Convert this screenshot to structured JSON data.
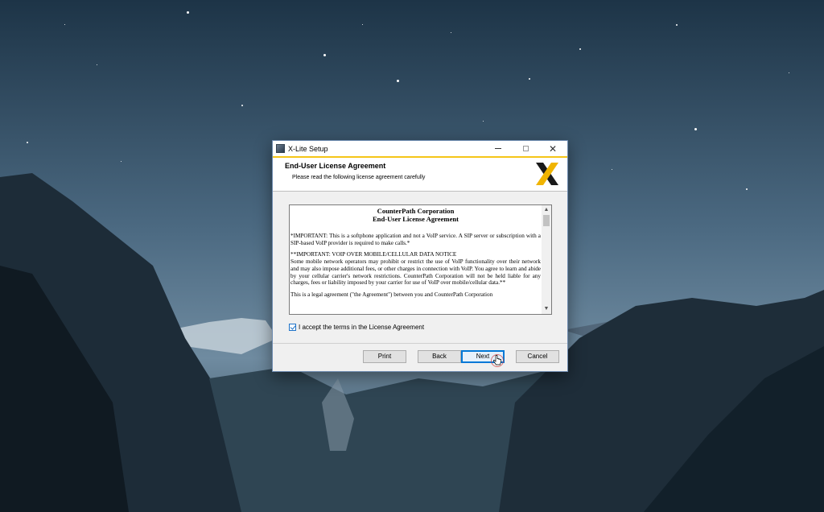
{
  "window": {
    "title": "X-Lite Setup",
    "controls": {
      "minimize": "minimize-icon",
      "maximize": "maximize-icon",
      "close": "close-icon"
    }
  },
  "header": {
    "title": "End-User License Agreement",
    "subtitle": "Please read the following license agreement carefully",
    "logo": "x-lite-logo"
  },
  "license": {
    "company": "CounterPath Corporation",
    "doc_title": "End-User License Agreement",
    "paragraphs": [
      "*IMPORTANT: This is a softphone application and not a VoIP service. A SIP server or subscription with a SIP-based VoIP provider is required to make calls.*",
      "**IMPORTANT: VOIP OVER MOBILE/CELLULAR DATA NOTICE",
      "Some mobile network operators may prohibit or restrict the use of VoIP functionality over their network and may also impose additional fees, or other charges in connection with VoIP. You agree to learn and abide by your cellular carrier's network restrictions. CounterPath Corporation will not be held liable for any charges, fees or liability imposed by your carrier for use of VoIP over mobile/cellular data.**",
      "This is a legal agreement (\"the Agreement\") between you and CounterPath Corporation"
    ]
  },
  "accept": {
    "label": "I accept the terms in the License Agreement",
    "checked": true
  },
  "buttons": {
    "print": "Print",
    "back": "Back",
    "next": "Next",
    "cancel": "Cancel"
  },
  "colors": {
    "accent": "#f5c518",
    "focus": "#0078d7",
    "logo_dark": "#1a1a1a",
    "logo_gold": "#f0b400"
  }
}
